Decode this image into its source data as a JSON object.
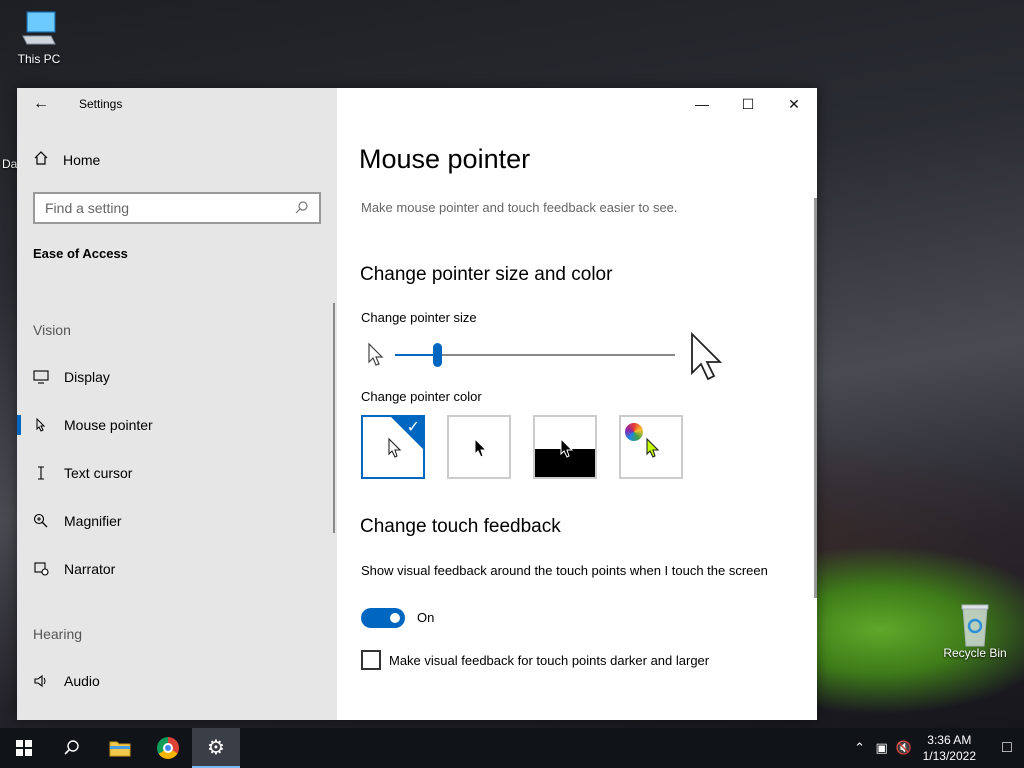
{
  "desktop": {
    "this_pc_label": "This PC",
    "recycle_bin_label": "Recycle Bin",
    "partial_label": "Da"
  },
  "window": {
    "app_title": "Settings",
    "home_label": "Home",
    "search_placeholder": "Find a setting",
    "section_title": "Ease of Access",
    "groups": {
      "vision_label": "Vision",
      "hearing_label": "Hearing"
    },
    "nav_items": [
      {
        "label": "Display",
        "icon": "monitor-icon"
      },
      {
        "label": "Mouse pointer",
        "icon": "mouse-pointer-icon",
        "selected": true
      },
      {
        "label": "Text cursor",
        "icon": "text-cursor-icon"
      },
      {
        "label": "Magnifier",
        "icon": "magnifier-icon"
      },
      {
        "label": "Narrator",
        "icon": "narrator-icon"
      },
      {
        "label": "Audio",
        "icon": "speaker-icon"
      }
    ]
  },
  "content": {
    "page_title": "Mouse pointer",
    "subtitle": "Make mouse pointer and touch feedback easier to see.",
    "section1_title": "Change pointer size and color",
    "pointer_size_label": "Change pointer size",
    "pointer_size_value": 0.15,
    "pointer_color_label": "Change pointer color",
    "color_options": [
      {
        "name": "white",
        "selected": true
      },
      {
        "name": "black",
        "selected": false
      },
      {
        "name": "inverted",
        "selected": false
      },
      {
        "name": "custom",
        "selected": false
      }
    ],
    "section2_title": "Change touch feedback",
    "touch_feedback_label": "Show visual feedback around the touch points when I touch the screen",
    "toggle_state": "On",
    "darker_checkbox_label": "Make visual feedback for touch points darker and larger",
    "darker_checked": false
  },
  "taskbar": {
    "time": "3:36 AM",
    "date": "1/13/2022"
  },
  "colors": {
    "accent": "#0067c0",
    "sidebar_bg": "#e6e6e6",
    "taskbar_bg": "#101318"
  }
}
